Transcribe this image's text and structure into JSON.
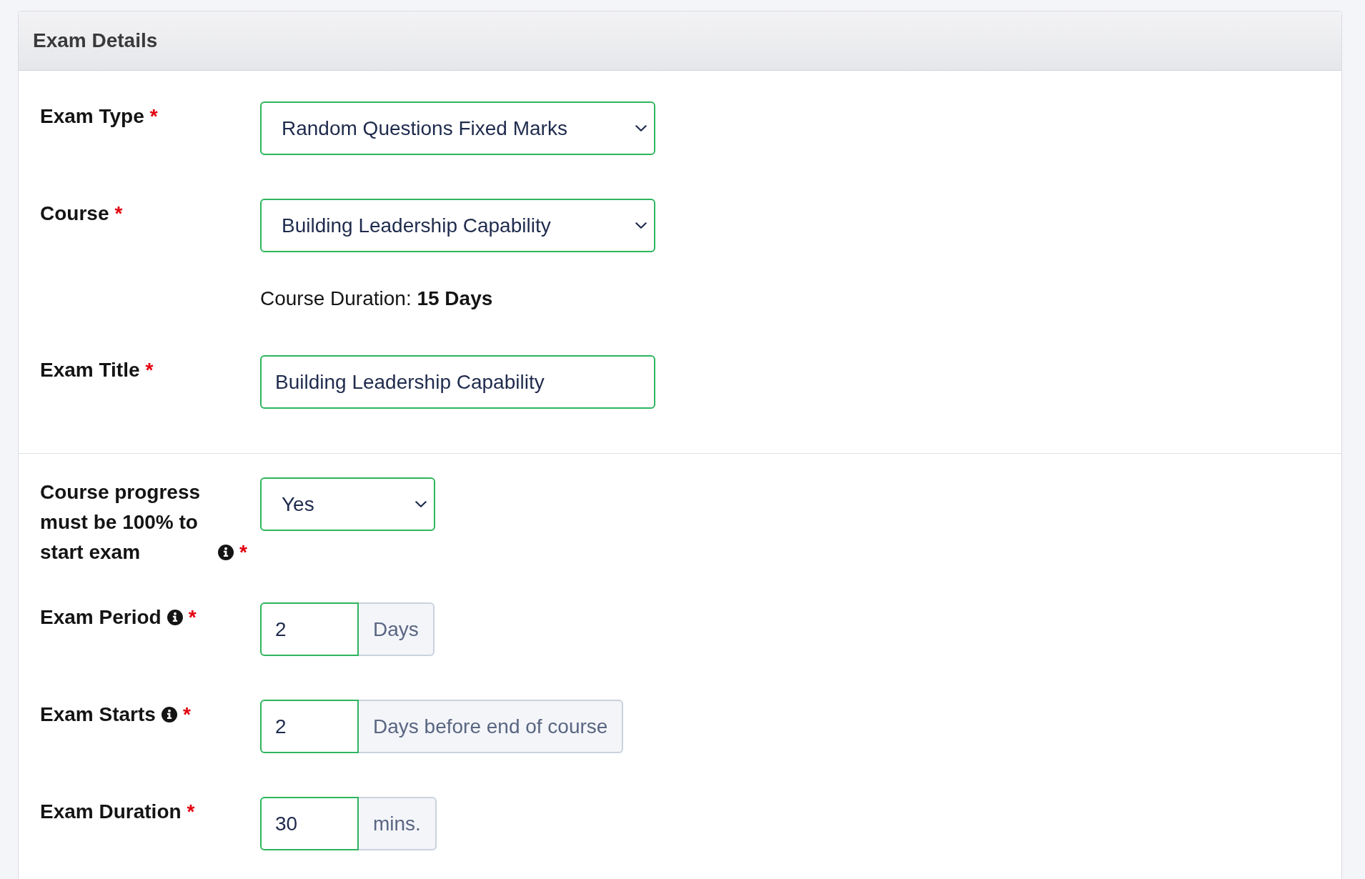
{
  "panel": {
    "title": "Exam Details"
  },
  "sections": [
    {
      "fields": [
        {
          "kind": "select",
          "label": "Exam Type",
          "info": false,
          "required_mark": "*",
          "value": "Random Questions Fixed Marks"
        },
        {
          "kind": "select",
          "label": "Course",
          "info": false,
          "required_mark": "*",
          "value": "Building Leadership Capability",
          "note": "Course Duration: **15 Days**"
        },
        {
          "kind": "text",
          "label": "Exam Title",
          "info": false,
          "required_mark": "*",
          "value": "Building Leadership Capability"
        }
      ]
    },
    {
      "fields": [
        {
          "kind": "select",
          "label": "Course progress must be 100% to start exam",
          "info": true,
          "required_mark": "*",
          "value": "Yes"
        },
        {
          "kind": "number_unit",
          "label": "Exam Period",
          "info": true,
          "required_mark": "*",
          "value": "2",
          "unit": "Days"
        },
        {
          "kind": "number_unit",
          "label": "Exam Starts",
          "info": true,
          "required_mark": "*",
          "value": "2",
          "unit": "Days before end of course"
        },
        {
          "kind": "number_unit",
          "label": "Exam Duration",
          "info": false,
          "required_mark": "*",
          "value": "30",
          "unit": "mins."
        }
      ]
    }
  ]
}
